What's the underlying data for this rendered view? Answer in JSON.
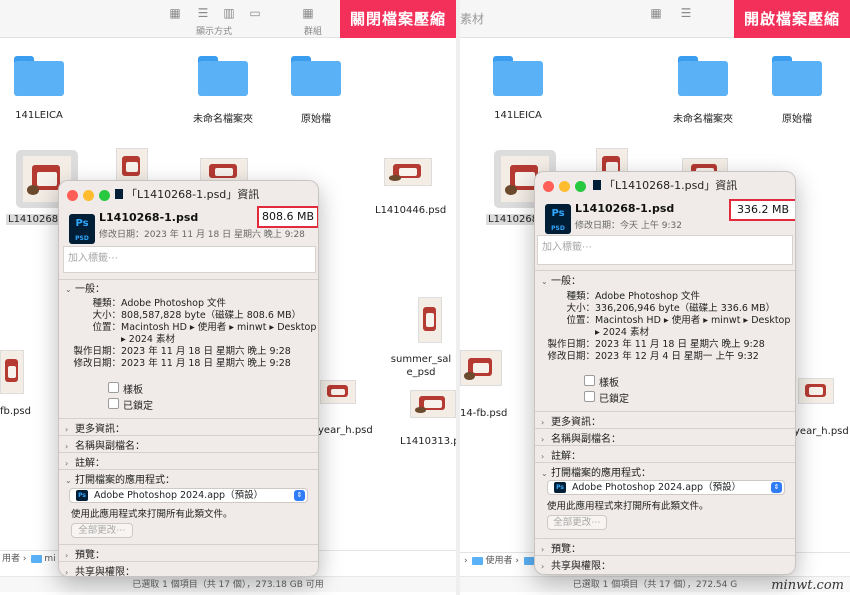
{
  "left": {
    "banner": "關閉檔案壓縮",
    "toolbar": {
      "view_label": "顯示方式",
      "group_label": "群組"
    },
    "folders": [
      "141LEICA",
      "未命名檔案夾",
      "原始檔"
    ],
    "files": [
      "L1410268-1",
      "L1410446.psd",
      "summer_sale_psd",
      "fb.psd",
      "year_h.psd",
      "L1410313.ps"
    ],
    "path": [
      "用者",
      "mi"
    ],
    "status": "已選取 1 個項目（共 17 個），273.18 GB 可用",
    "info": {
      "title": "「L1410268-1.psd」資訊",
      "file_name": "L1410268-1.psd",
      "file_size": "808.6 MB",
      "modified": "修改日期：2023 年 11 月 18 日 星期六 晚上 9:28",
      "tags_placeholder": "加入標籤⋯",
      "general_header": "一般：",
      "rows": [
        {
          "k": "種類：",
          "v": "Adobe Photoshop 文件"
        },
        {
          "k": "大小：",
          "v": "808,587,828 byte（磁碟上 808.6 MB）"
        },
        {
          "k": "位置：",
          "v": "Macintosh HD ▸ 使用者 ▸ minwt ▸ Desktop"
        },
        {
          "k": "",
          "v": "▸ 2024 素材"
        },
        {
          "k": "製作日期：",
          "v": "2023 年 11 月 18 日 星期六 晚上 9:28"
        },
        {
          "k": "修改日期：",
          "v": "2023 年 11 月 18 日 星期六 晚上 9:28"
        }
      ],
      "template_label": "樣板",
      "locked_label": "已鎖定",
      "more_info": "更多資訊：",
      "name_ext": "名稱與副檔名：",
      "comments": "註解：",
      "open_with": "打開檔案的應用程式：",
      "app": "Adobe Photoshop 2024.app（預設）",
      "use_app_note": "使用此應用程式來打開所有此類文件。",
      "change_all": "全部更改⋯",
      "preview": "預覽：",
      "sharing": "共享與權限："
    }
  },
  "right": {
    "banner": "開啟檔案壓縮",
    "toolbar": {
      "partial_title": "素材"
    },
    "folders": [
      "141LEICA",
      "未命名檔案夾",
      "原始檔"
    ],
    "files": [
      "L1410268-1",
      "14-fb.psd",
      "year_h.psd"
    ],
    "path": [
      "使用者",
      "mi"
    ],
    "status": "已選取 1 個項目（共 17 個），272.54 G",
    "info": {
      "title": "「L1410268-1.psd」資訊",
      "file_name": "L1410268-1.psd",
      "file_size": "336.2 MB",
      "modified": "修改日期：今天 上午 9:32",
      "tags_placeholder": "加入標籤⋯",
      "general_header": "一般：",
      "rows": [
        {
          "k": "種類：",
          "v": "Adobe Photoshop 文件"
        },
        {
          "k": "大小：",
          "v": "336,206,946 byte（磁碟上 336.6 MB）"
        },
        {
          "k": "位置：",
          "v": "Macintosh HD ▸ 使用者 ▸ minwt ▸ Desktop"
        },
        {
          "k": "",
          "v": "▸ 2024 素材"
        },
        {
          "k": "製作日期：",
          "v": "2023 年 11 月 18 日 星期六 晚上 9:28"
        },
        {
          "k": "修改日期：",
          "v": "2023 年 12 月 4 日 星期一 上午 9:32"
        }
      ],
      "template_label": "樣板",
      "locked_label": "已鎖定",
      "more_info": "更多資訊：",
      "name_ext": "名稱與副檔名：",
      "comments": "註解：",
      "open_with": "打開檔案的應用程式：",
      "app": "Adobe Photoshop 2024.app（預設）",
      "use_app_note": "使用此應用程式來打開所有此類文件。",
      "change_all": "全部更改⋯",
      "preview": "預覽：",
      "sharing": "共享與權限："
    }
  },
  "watermark": "minwt.com",
  "colors": {
    "highlight": "#f2305a",
    "size_box": "#e12a3b",
    "folder": "#5ab1f5"
  },
  "icons": {
    "doc": "photoshop-psd-icon",
    "folder": "folder-icon",
    "chevron": "chevron-icon"
  }
}
